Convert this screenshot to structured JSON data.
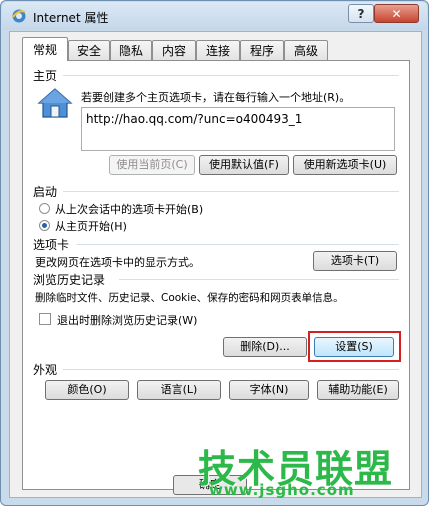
{
  "window": {
    "title": "Internet 属性",
    "help_label": "?",
    "close_label": "✕"
  },
  "tabs": [
    "常规",
    "安全",
    "隐私",
    "内容",
    "连接",
    "程序",
    "高级"
  ],
  "homepage": {
    "section_label": "主页",
    "description": "若要创建多个主页选项卡，请在每行输入一个地址(R)。",
    "url": "http://hao.qq.com/?unc=o400493_1",
    "use_current_label": "使用当前页(C)",
    "use_default_label": "使用默认值(F)",
    "use_new_tab_label": "使用新选项卡(U)"
  },
  "startup": {
    "section_label": "启动",
    "option1_label": "从上次会话中的选项卡开始(B)",
    "option2_label": "从主页开始(H)",
    "selected": "option2"
  },
  "tabs_section": {
    "section_label": "选项卡",
    "description": "更改网页在选项卡中的显示方式。",
    "button_label": "选项卡(T)"
  },
  "history": {
    "section_label": "浏览历史记录",
    "description": "删除临时文件、历史记录、Cookie、保存的密码和网页表单信息。",
    "checkbox_label": "退出时删除浏览历史记录(W)",
    "checkbox_checked": false,
    "delete_label": "删除(D)...",
    "settings_label": "设置(S)"
  },
  "appearance": {
    "section_label": "外观",
    "colors_label": "颜色(O)",
    "languages_label": "语言(L)",
    "fonts_label": "字体(N)",
    "accessibility_label": "辅助功能(E)"
  },
  "footer": {
    "ok_label": "确定"
  },
  "watermark": {
    "text": "技术员联盟",
    "url": "www.jsgho.com"
  },
  "colors": {
    "highlight": "#d42020",
    "watermark": "#2db84a"
  }
}
